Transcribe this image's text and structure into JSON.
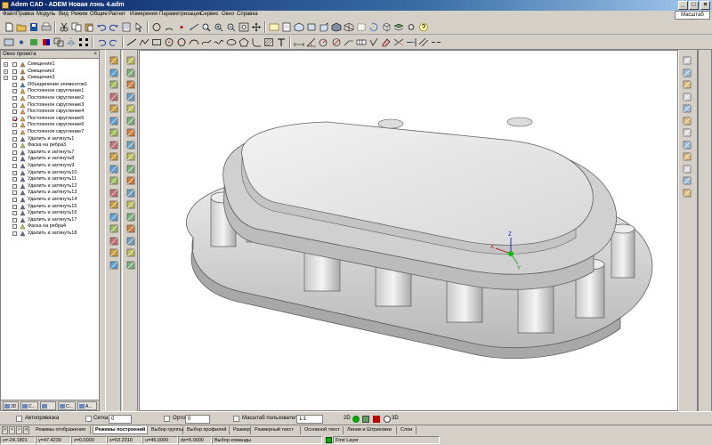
{
  "window": {
    "title": "Adem CAD - ADEM Новая лэнь 4.adm",
    "minimize": "_",
    "maximize": "□",
    "close": "×"
  },
  "menu": [
    "Файл",
    "Правка",
    "Модуль",
    "Вид",
    "Режим",
    "Общие",
    "Расчет",
    "Измерения",
    "Параметризация",
    "Сервис",
    "Окно",
    "Справка"
  ],
  "scale_label": "Масштаб =1:1",
  "project_panel": {
    "title": "Окно проекта",
    "items": [
      {
        "label": "Смещение1",
        "expand": true,
        "checked": false,
        "icon": "offset-icon"
      },
      {
        "label": "Смещение2",
        "expand": true,
        "checked": false,
        "icon": "offset-icon"
      },
      {
        "label": "Смещение3",
        "expand": true,
        "checked": false,
        "icon": "offset-icon"
      },
      {
        "label": "Объединение элементов1",
        "expand": false,
        "checked": false,
        "icon": "union-icon"
      },
      {
        "label": "Постоянное скругление1",
        "expand": false,
        "checked": false,
        "icon": "fillet-icon"
      },
      {
        "label": "Постоянное скругление2",
        "expand": false,
        "checked": false,
        "icon": "fillet-icon"
      },
      {
        "label": "Постоянное скругление3",
        "expand": false,
        "checked": false,
        "icon": "fillet-icon"
      },
      {
        "label": "Постоянное скругление4",
        "expand": false,
        "checked": false,
        "icon": "fillet-icon"
      },
      {
        "label": "Постоянное скругление5",
        "expand": false,
        "checked": true,
        "icon": "fillet-icon"
      },
      {
        "label": "Постоянное скругление6",
        "expand": false,
        "checked": false,
        "icon": "fillet-icon"
      },
      {
        "label": "Постоянное скругление7",
        "expand": false,
        "checked": false,
        "icon": "fillet-icon"
      },
      {
        "label": "Удалить и затянуть1",
        "expand": false,
        "checked": false,
        "icon": "remove-icon"
      },
      {
        "label": "Фаска на ребра3",
        "expand": false,
        "checked": false,
        "icon": "chamfer-icon"
      },
      {
        "label": "Удалить и затянуть7",
        "expand": false,
        "checked": false,
        "icon": "remove-icon"
      },
      {
        "label": "Удалить и затянуть8",
        "expand": false,
        "checked": false,
        "icon": "remove-icon"
      },
      {
        "label": "Удалить и затянуть9",
        "expand": false,
        "checked": false,
        "icon": "remove-icon"
      },
      {
        "label": "Удалить и затянуть10",
        "expand": false,
        "checked": false,
        "icon": "remove-icon"
      },
      {
        "label": "Удалить и затянуть11",
        "expand": false,
        "checked": false,
        "icon": "remove-icon"
      },
      {
        "label": "Удалить и затянуть12",
        "expand": false,
        "checked": false,
        "icon": "remove-icon"
      },
      {
        "label": "Удалить и затянуть13",
        "expand": false,
        "checked": false,
        "icon": "remove-icon"
      },
      {
        "label": "Удалить и затянуть14",
        "expand": false,
        "checked": false,
        "icon": "remove-icon"
      },
      {
        "label": "Удалить и затянуть15",
        "expand": false,
        "checked": false,
        "icon": "remove-icon"
      },
      {
        "label": "Удалить и затянуть16",
        "expand": false,
        "checked": false,
        "icon": "remove-icon"
      },
      {
        "label": "Удалить и затянуть17",
        "expand": false,
        "checked": false,
        "icon": "remove-icon"
      },
      {
        "label": "Фаска на ребра4",
        "expand": false,
        "checked": false,
        "icon": "chamfer-icon"
      },
      {
        "label": "Удалить и затянуть18",
        "expand": false,
        "checked": false,
        "icon": "remove-icon"
      }
    ],
    "tabs": [
      "3D",
      "C...",
      "",
      "C...",
      "A..."
    ]
  },
  "snap_bar": {
    "autosnap": "Автопривязка",
    "grid": "Сетка",
    "grid_value": "0",
    "ortho": "Орто",
    "ortho_value": "0",
    "user_scale": "Масштаб пользователя",
    "user_scale_value": "1:1",
    "mode_2d": "2D",
    "mode_3d": "3D"
  },
  "mode_tabs": [
    "Режимы отображения",
    "Режимы построений",
    "Выбор группы",
    "Выбор профилей",
    "Размер",
    "Размерный текст",
    "Основной текст",
    "Линии и Штриховки",
    "Слои"
  ],
  "active_mode_tab": 1,
  "nav_buttons": [
    "|<",
    "<",
    ">",
    ">|"
  ],
  "coords": {
    "x": "x=-24.1801",
    "y": "y=47.4230",
    "z": "z=0.0000",
    "s": "s=53.2310",
    "u": "u=45.0000",
    "d": "dz=5.0000",
    "command": "Выбор команды",
    "layer": "First Layer"
  },
  "colors": {
    "accent": "#0a246a",
    "axis_x": "#c00000",
    "axis_y": "#00a000",
    "axis_z": "#0000c0"
  }
}
